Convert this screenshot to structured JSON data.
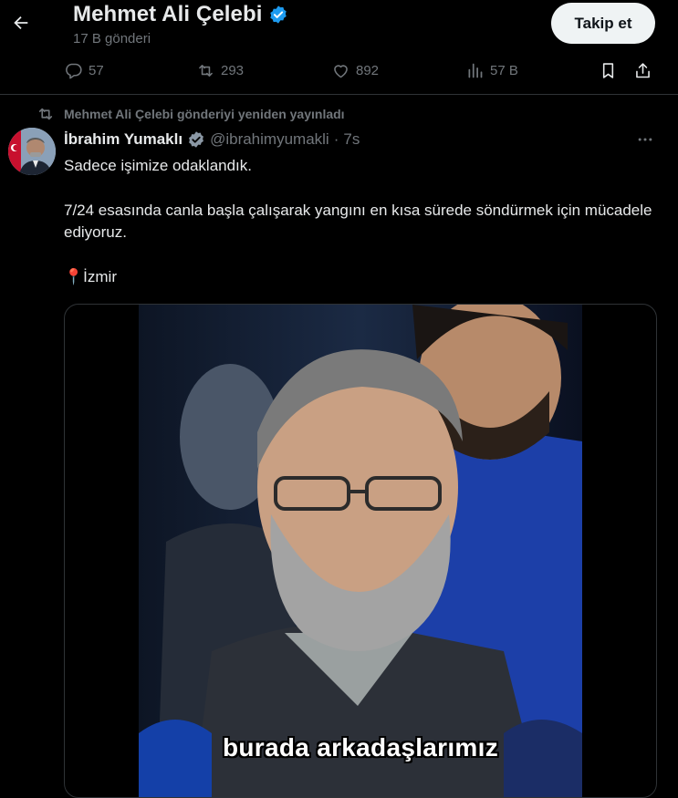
{
  "header": {
    "title": "Mehmet Ali Çelebi",
    "subtitle": "17 B gönderi",
    "follow_label": "Takip et"
  },
  "actions": {
    "replies": "57",
    "reposts": "293",
    "likes": "892",
    "views": "57 B"
  },
  "tweet": {
    "repost_context": "Mehmet Ali Çelebi gönderiyi yeniden yayınladı",
    "author_name": "İbrahim Yumaklı",
    "handle": "@ibrahimyumakli",
    "separator": "·",
    "time": "7s",
    "text": {
      "line1": "Sadece işimize odaklandık.",
      "line2": "7/24 esasında canla başla çalışarak yangını en kısa sürede söndürmek için mücadele ediyoruz.",
      "location_pin": "📍",
      "location": "İzmir"
    },
    "video_caption": "burada arkadaşlarımız"
  },
  "colors": {
    "background": "#000000",
    "text_primary": "#e7e9ea",
    "text_secondary": "#71767b",
    "verified": "#1d9bf0",
    "border": "#2f3336"
  },
  "icons": [
    "back-arrow-icon",
    "verified-badge-icon",
    "reply-icon",
    "repost-icon",
    "like-icon",
    "views-icon",
    "bookmark-icon",
    "share-icon",
    "repost-context-icon",
    "more-icon"
  ]
}
